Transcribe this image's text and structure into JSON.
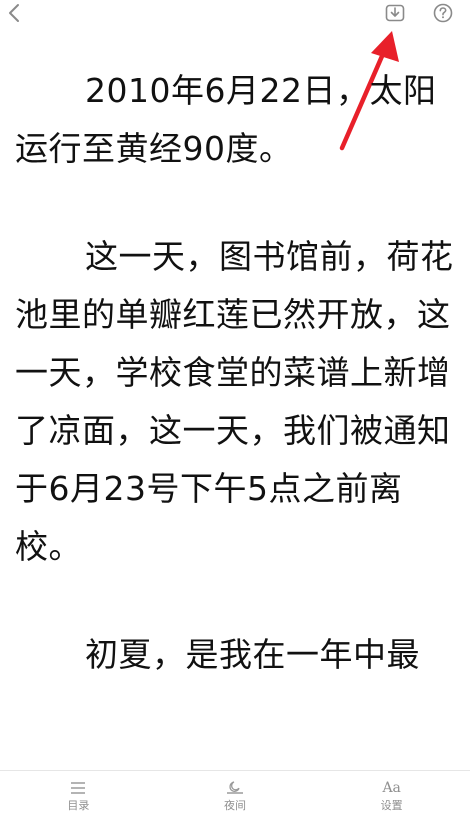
{
  "header": {
    "back_icon": "chevron-left-icon",
    "download_icon": "download-icon",
    "help_icon": "question-circle-icon"
  },
  "annotation": {
    "color": "#e8202a"
  },
  "content": {
    "paragraphs": [
      "2010年6月22日，太阳运行至黄经90度。",
      "这一天，图书馆前，荷花池里的单瓣红莲已然开放，这一天，学校食堂的菜谱上新增了凉面，这一天，我们被通知于6月23号下午5点之前离校。",
      "初夏，是我在一年中最"
    ]
  },
  "bottom_nav": {
    "items": [
      {
        "label": "目录",
        "icon": "list-icon"
      },
      {
        "label": "夜间",
        "icon": "night-mode-icon"
      },
      {
        "label": "设置",
        "icon": "font-settings-icon",
        "glyph": "Aa"
      }
    ]
  }
}
